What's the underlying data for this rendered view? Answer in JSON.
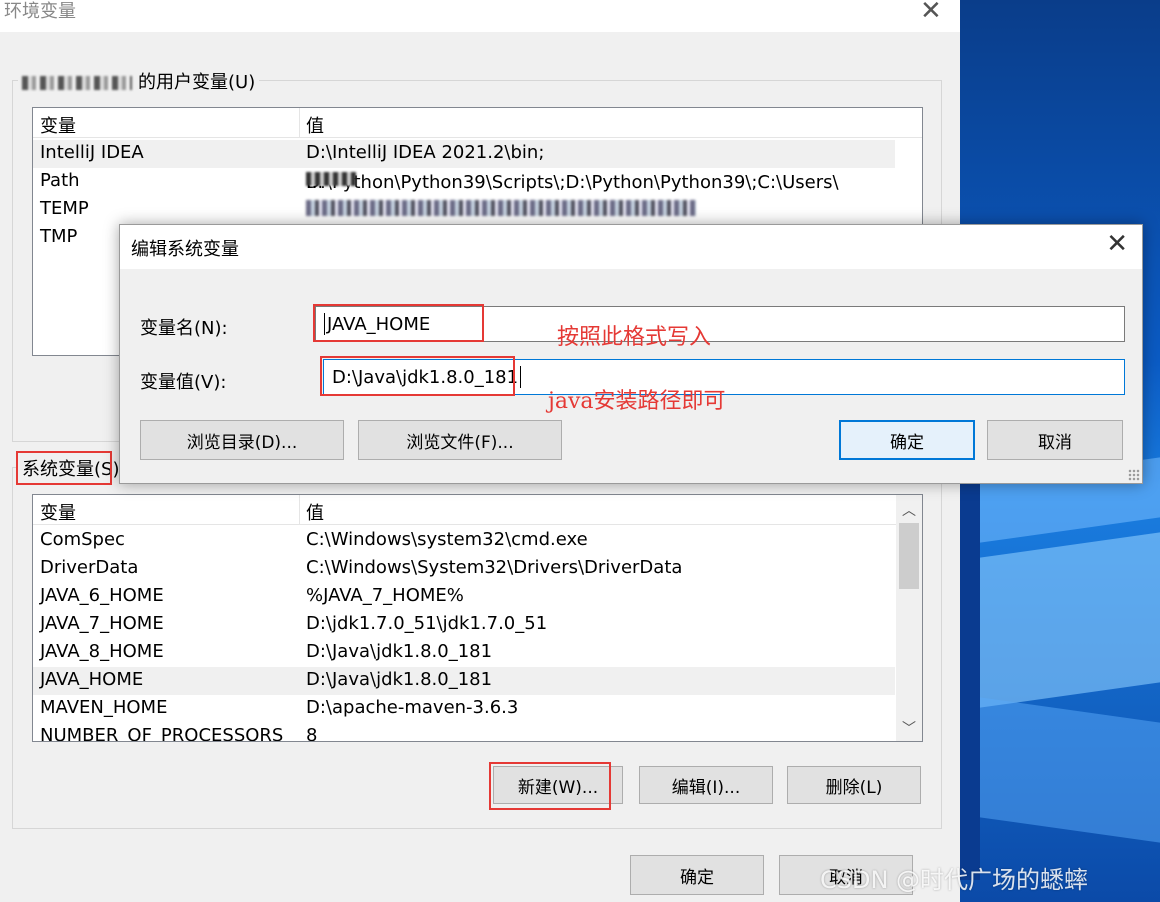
{
  "window": {
    "title": "环境变量",
    "close_glyph": "✕"
  },
  "user_vars": {
    "group_label": "的用户变量(U)",
    "col_var": "变量",
    "col_val": "值",
    "rows": [
      {
        "name": "IntelliJ IDEA",
        "value": "D:\\IntelliJ IDEA 2021.2\\bin;"
      },
      {
        "name": "Path",
        "value": "D:\\Python\\Python39\\Scripts\\;D:\\Python\\Python39\\;C:\\Users\\"
      },
      {
        "name": "TEMP",
        "value": ""
      },
      {
        "name": "TMP",
        "value": ""
      }
    ],
    "path_suffix": "..."
  },
  "system_vars": {
    "group_label": "系统变量(S)",
    "col_var": "变量",
    "col_val": "值",
    "rows": [
      {
        "name": "ComSpec",
        "value": "C:\\Windows\\system32\\cmd.exe"
      },
      {
        "name": "DriverData",
        "value": "C:\\Windows\\System32\\Drivers\\DriverData"
      },
      {
        "name": "JAVA_6_HOME",
        "value": "%JAVA_7_HOME%"
      },
      {
        "name": "JAVA_7_HOME",
        "value": "D:\\jdk1.7.0_51\\jdk1.7.0_51"
      },
      {
        "name": "JAVA_8_HOME",
        "value": "D:\\Java\\jdk1.8.0_181"
      },
      {
        "name": "JAVA_HOME",
        "value": "D:\\Java\\jdk1.8.0_181"
      },
      {
        "name": "MAVEN_HOME",
        "value": "D:\\apache-maven-3.6.3"
      },
      {
        "name": "NUMBER_OF_PROCESSORS",
        "value": "8"
      }
    ],
    "selected_row": "JAVA_HOME",
    "buttons": {
      "new": "新建(W)...",
      "edit": "编辑(I)...",
      "delete": "删除(L)"
    }
  },
  "footer": {
    "ok": "确定",
    "cancel": "取消"
  },
  "edit_dialog": {
    "title": "编辑系统变量",
    "close_glyph": "✕",
    "name_label": "变量名(N):",
    "name_value": "JAVA_HOME",
    "value_label": "变量值(V):",
    "value_value": "D:\\Java\\jdk1.8.0_181",
    "browse_dir": "浏览目录(D)...",
    "browse_file": "浏览文件(F)...",
    "ok": "确定",
    "cancel": "取消"
  },
  "annotations": {
    "name_note": "按照此格式写入",
    "value_note": "java安装路径即可",
    "color": "#e53935"
  },
  "watermark": "CSDN @时代广场的蟋蟀"
}
